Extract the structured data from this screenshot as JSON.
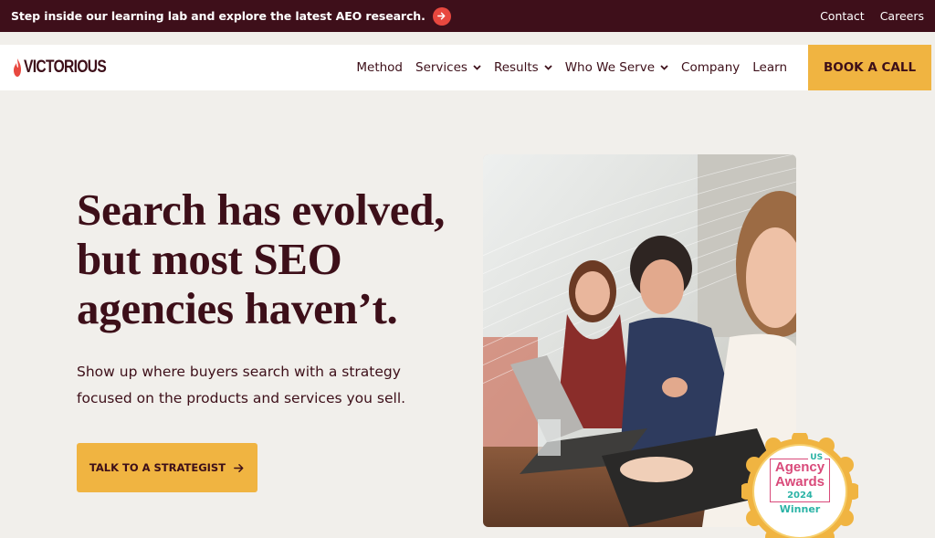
{
  "announcement": {
    "text": "Step inside our learning lab and explore the latest AEO research.",
    "links": [
      "Contact",
      "Careers"
    ]
  },
  "header": {
    "logo_text": "VICTORIOUS",
    "menu": [
      {
        "label": "Method",
        "has_dropdown": false
      },
      {
        "label": "Services",
        "has_dropdown": true
      },
      {
        "label": "Results",
        "has_dropdown": true
      },
      {
        "label": "Who We Serve",
        "has_dropdown": true
      },
      {
        "label": "Company",
        "has_dropdown": false
      },
      {
        "label": "Learn",
        "has_dropdown": false
      }
    ],
    "cta_label": "BOOK A CALL"
  },
  "hero": {
    "headline_lines": [
      "Search has evolved,",
      "but most SEO",
      "agencies haven’t."
    ],
    "subtext_lines": [
      "Show up where buyers search with a strategy",
      "focused on the products and services you sell."
    ],
    "cta_label": "TALK TO A STRATEGIST",
    "image_icon": "photo-of-laughing-team-at-laptops"
  },
  "award_badge": {
    "country": "US",
    "line1": "Agency",
    "line2": "Awards",
    "year": "2024",
    "status": "Winner"
  },
  "colors": {
    "brand_dark": "#3e0f1a",
    "accent_gold": "#f0b441",
    "accent_red": "#e8483f",
    "background": "#f1efeb",
    "badge_pink": "#d94a7a",
    "badge_teal": "#2bb3a6"
  }
}
